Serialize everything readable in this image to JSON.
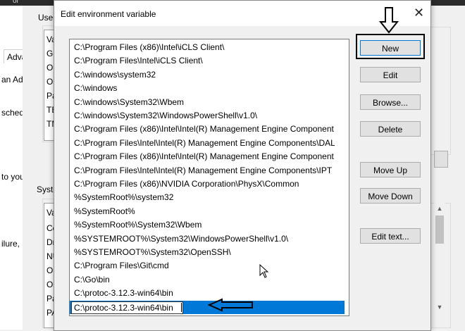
{
  "background": {
    "topstrip_text": "or",
    "left_fragments": [
      "an Ad",
      "schedu",
      "to your",
      "ilure, a"
    ],
    "user_group_label": "User",
    "user_list_fragments": [
      "Va",
      "GO",
      "On",
      "On",
      "Pa",
      "TE",
      "TM"
    ],
    "adv_tab_label": "Adva",
    "system_group_label": "Syste",
    "system_list_fragments": [
      "Va",
      "Co",
      "Dr",
      "NU",
      "On",
      "OS",
      "Pa",
      "PA"
    ]
  },
  "dialog": {
    "title": "Edit environment variable",
    "close_glyph": "✕"
  },
  "path_list": {
    "items": [
      "C:\\Program Files (x86)\\Intel\\iCLS Client\\",
      "C:\\Program Files\\Intel\\iCLS Client\\",
      "C:\\windows\\system32",
      "C:\\windows",
      "C:\\windows\\System32\\Wbem",
      "C:\\windows\\System32\\WindowsPowerShell\\v1.0\\",
      "C:\\Program Files (x86)\\Intel\\Intel(R) Management Engine Component...",
      "C:\\Program Files\\Intel\\Intel(R) Management Engine Components\\DAL",
      "C:\\Program Files (x86)\\Intel\\Intel(R) Management Engine Component...",
      "C:\\Program Files\\Intel\\Intel(R) Management Engine Components\\IPT",
      "C:\\Program Files (x86)\\NVIDIA Corporation\\PhysX\\Common",
      "%SystemRoot%\\system32",
      "%SystemRoot%",
      "%SystemRoot%\\System32\\Wbem",
      "%SYSTEMROOT%\\System32\\WindowsPowerShell\\v1.0\\",
      "%SYSTEMROOT%\\System32\\OpenSSH\\",
      "C:\\Program Files\\Git\\cmd",
      "C:\\Go\\bin",
      "C:\\protoc-3.12.3-win64\\bin"
    ],
    "editing_value": "C:\\protoc-3.12.3-win64\\bin"
  },
  "buttons": {
    "new": "New",
    "edit": "Edit",
    "browse": "Browse...",
    "delete": "Delete",
    "move_up": "Move Up",
    "move_down": "Move Down",
    "edit_text": "Edit text..."
  },
  "colors": {
    "selection": "#0078d7",
    "dialog_bg": "#f0f0f0",
    "button_bg": "#e1e1e1"
  },
  "icons": {
    "close": "close-icon",
    "annotation_down": "down-arrow-annotation-icon",
    "annotation_left": "left-arrow-annotation-icon",
    "cursor": "mouse-pointer-icon"
  }
}
